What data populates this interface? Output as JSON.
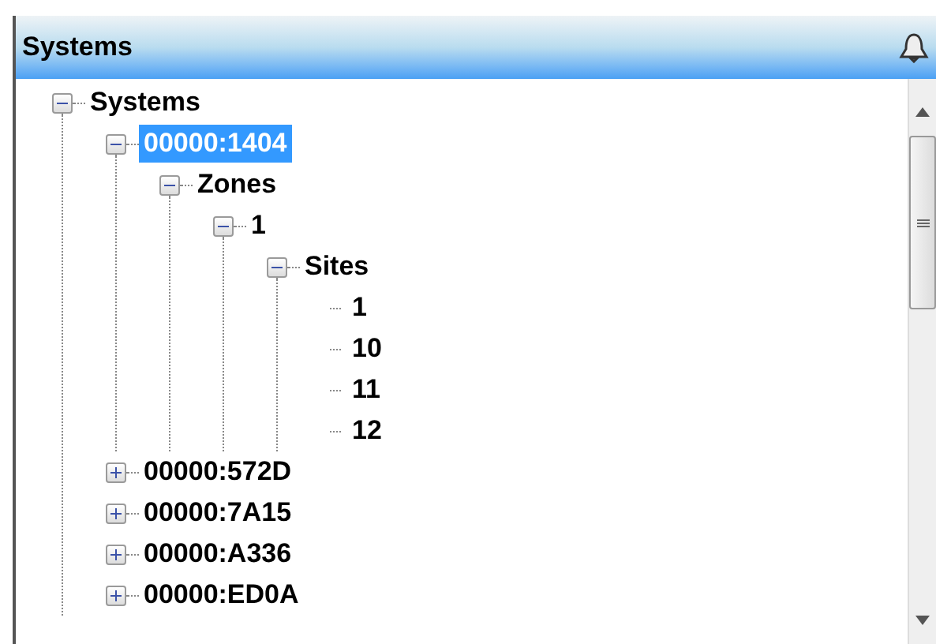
{
  "panel": {
    "title": "Systems"
  },
  "tree": [
    {
      "label": "Systems",
      "expanded": true,
      "selected": false,
      "children": [
        {
          "label": "00000:1404",
          "expanded": true,
          "selected": true,
          "children": [
            {
              "label": "Zones",
              "expanded": true,
              "selected": false,
              "children": [
                {
                  "label": "1",
                  "expanded": true,
                  "selected": false,
                  "children": [
                    {
                      "label": "Sites",
                      "expanded": true,
                      "selected": false,
                      "children": [
                        {
                          "label": "1",
                          "selected": false
                        },
                        {
                          "label": "10",
                          "selected": false
                        },
                        {
                          "label": "11",
                          "selected": false
                        },
                        {
                          "label": "12",
                          "selected": false
                        }
                      ]
                    }
                  ]
                }
              ]
            }
          ]
        },
        {
          "label": "00000:572D",
          "expanded": false,
          "selected": false
        },
        {
          "label": "00000:7A15",
          "expanded": false,
          "selected": false
        },
        {
          "label": "00000:A336",
          "expanded": false,
          "selected": false
        },
        {
          "label": "00000:ED0A",
          "expanded": false,
          "selected": false
        }
      ]
    }
  ]
}
